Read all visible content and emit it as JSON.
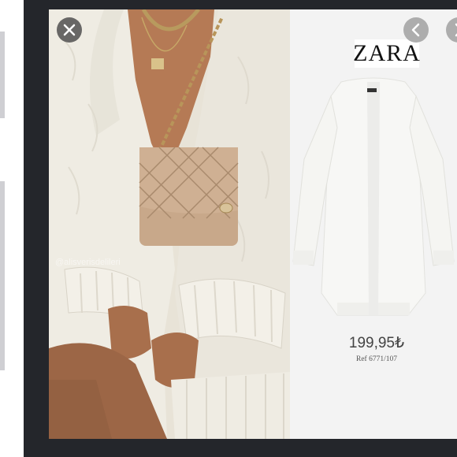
{
  "brand": {
    "logo_text": "ZARA"
  },
  "product": {
    "price": "199,95₺",
    "ref": "Ref 6771/107"
  },
  "photo": {
    "watermark": "@alisverisdelileri"
  },
  "controls": {
    "close_icon": "close-icon",
    "prev_icon": "chevron-left-icon",
    "next_icon": "chevron-right-icon"
  },
  "colors": {
    "backdrop": "#24262b",
    "panel": "#f3f3f3",
    "sweater": "#ece8dd",
    "bag": "#c9a98a"
  }
}
